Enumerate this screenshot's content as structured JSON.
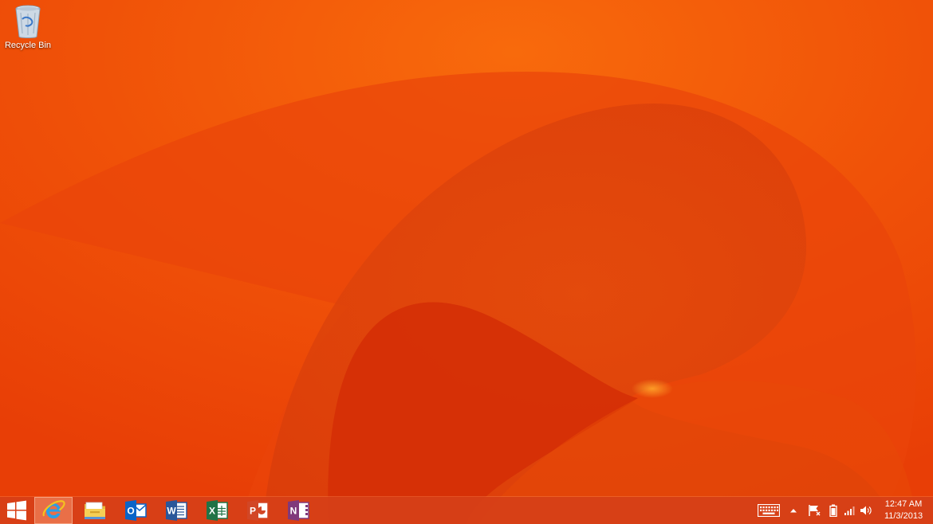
{
  "desktop": {
    "icons": [
      {
        "label": "Recycle Bin",
        "icon": "recycle-bin-icon"
      }
    ]
  },
  "taskbar": {
    "start": {
      "icon": "windows-logo-icon"
    },
    "pinned_apps": [
      {
        "name": "Internet Explorer",
        "icon": "internet-explorer-icon",
        "active": true
      },
      {
        "name": "File Explorer",
        "icon": "file-explorer-icon"
      },
      {
        "name": "Outlook",
        "icon": "outlook-icon",
        "letter": "O",
        "color": "#0a64c8"
      },
      {
        "name": "Word",
        "icon": "word-icon",
        "letter": "W",
        "color": "#2b579a"
      },
      {
        "name": "Excel",
        "icon": "excel-icon",
        "letter": "X",
        "color": "#217346"
      },
      {
        "name": "PowerPoint",
        "icon": "powerpoint-icon",
        "letter": "P",
        "color": "#d24726"
      },
      {
        "name": "OneNote",
        "icon": "onenote-icon",
        "letter": "N",
        "color": "#80397b"
      }
    ]
  },
  "system_tray": {
    "icons": [
      "touch-keyboard-icon",
      "show-hidden-icons-icon",
      "action-center-flag-icon",
      "battery-icon",
      "network-signal-icon",
      "volume-icon"
    ],
    "clock": {
      "time": "12:47 AM",
      "date": "11/3/2013"
    }
  },
  "colors": {
    "wallpaper_base": "#ee4a08",
    "taskbar": "#d64018",
    "text": "#ffffff"
  }
}
